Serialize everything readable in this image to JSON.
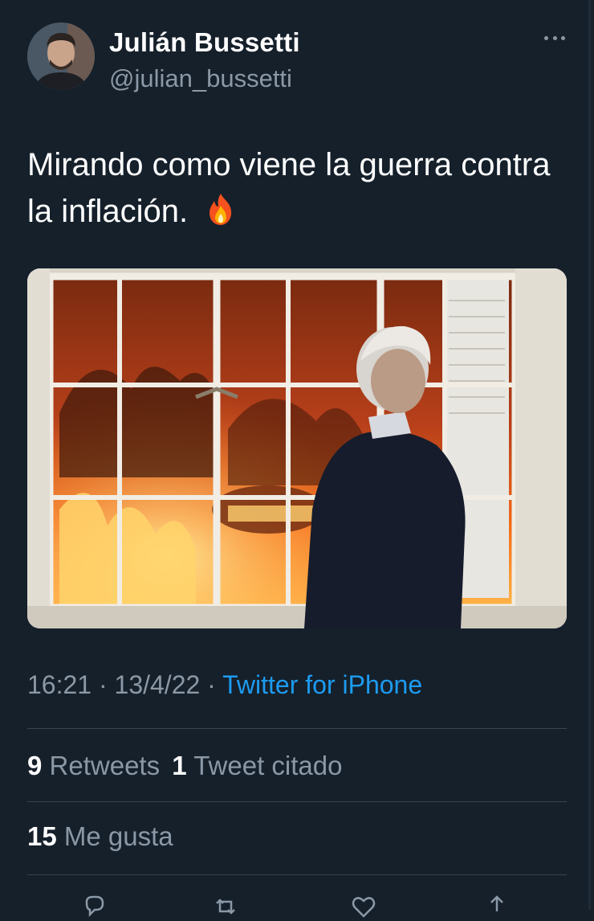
{
  "tweet": {
    "author_name": "Julián Bussetti",
    "author_handle": "@julian_bussetti",
    "text": "Mirando como viene la guerra contra la inflación.",
    "emoji_icon": "fire-emoji-icon",
    "time": "16:21",
    "date": "13/4/22",
    "separator": " · ",
    "source": "Twitter for iPhone"
  },
  "stats": {
    "retweets_count": "9",
    "retweets_label": "Retweets",
    "quotes_count": "1",
    "quotes_label": "Tweet citado",
    "likes_count": "15",
    "likes_label": "Me gusta"
  },
  "actions": [
    "reply-icon",
    "retweet-icon",
    "like-icon",
    "share-icon"
  ],
  "colors": {
    "background": "#15202b",
    "text": "#ffffff",
    "secondary": "#8b98a5",
    "link": "#1d9bf0",
    "divider": "#38444d"
  }
}
